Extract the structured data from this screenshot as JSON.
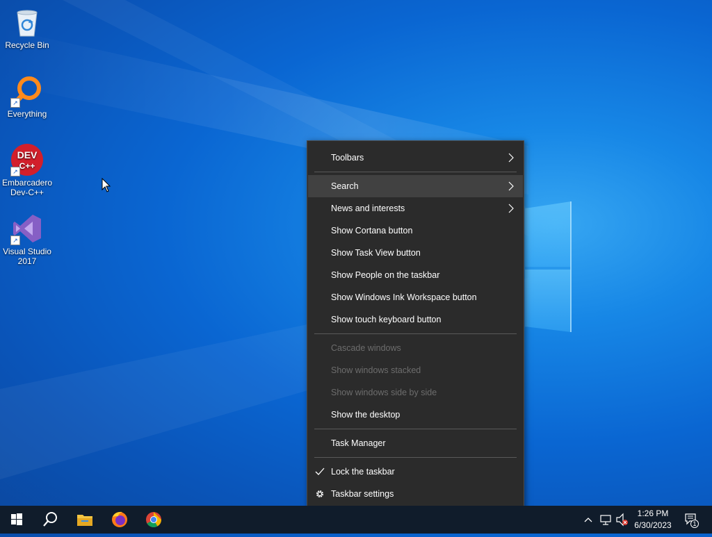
{
  "desktop": {
    "icons": [
      {
        "label": "Recycle Bin",
        "icon": "recycle-bin-icon"
      },
      {
        "label": "Everything",
        "icon": "everything-search-icon"
      },
      {
        "label": "Embarcadero Dev-C++",
        "icon": "devcpp-icon",
        "badge": "DEV C++"
      },
      {
        "label": "Visual Studio 2017",
        "icon": "visual-studio-icon"
      }
    ]
  },
  "context_menu": {
    "items": [
      {
        "label": "Toolbars",
        "submenu": true
      },
      {
        "label": "Search",
        "submenu": true,
        "highlighted": true
      },
      {
        "label": "News and interests",
        "submenu": true
      },
      {
        "label": "Show Cortana button"
      },
      {
        "label": "Show Task View button"
      },
      {
        "label": "Show People on the taskbar"
      },
      {
        "label": "Show Windows Ink Workspace button"
      },
      {
        "label": "Show touch keyboard button"
      },
      {
        "label": "Cascade windows",
        "disabled": true
      },
      {
        "label": "Show windows stacked",
        "disabled": true
      },
      {
        "label": "Show windows side by side",
        "disabled": true
      },
      {
        "label": "Show the desktop"
      },
      {
        "label": "Task Manager"
      },
      {
        "label": "Lock the taskbar",
        "checked": true
      },
      {
        "label": "Taskbar settings",
        "icon": "gear-icon"
      }
    ]
  },
  "taskbar": {
    "pinned": [
      "start-icon",
      "search-icon",
      "file-explorer-icon",
      "firefox-icon",
      "chrome-icon"
    ],
    "clock": {
      "time": "1:26 PM",
      "date": "6/30/2023"
    },
    "notification_count": "1"
  },
  "colors": {
    "menu_bg": "#2b2b2b",
    "menu_highlight": "#414141",
    "disabled_text": "#6d6d6d",
    "taskbar_bg": "#101c2b"
  }
}
